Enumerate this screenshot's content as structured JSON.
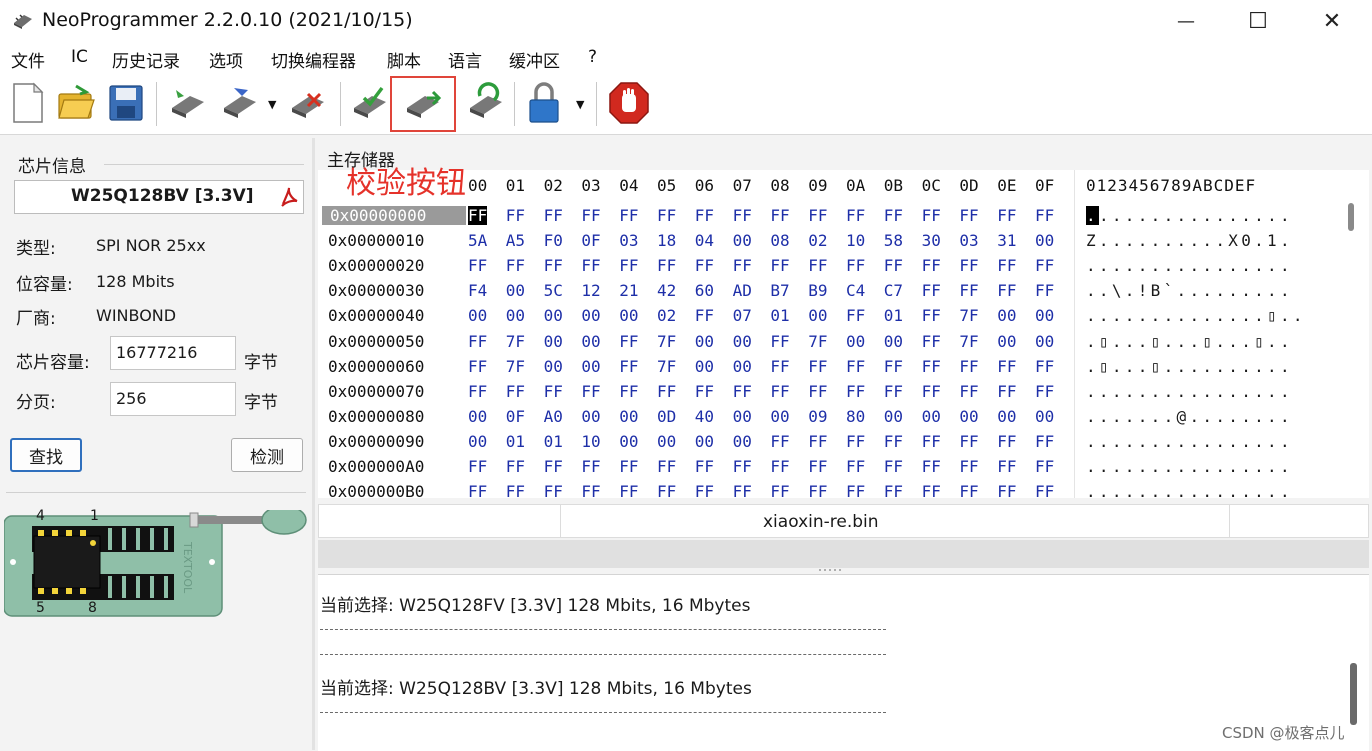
{
  "window": {
    "title": "NeoProgrammer 2.2.0.10 (2021/10/15)",
    "minimize_glyph": "—",
    "maximize_glyph": "☐",
    "close_glyph": "✕"
  },
  "menu": [
    "文件",
    "IC",
    "历史记录",
    "选项",
    "切换编程器",
    "脚本",
    "语言",
    "缓冲区",
    "?"
  ],
  "toolbar": {
    "icons": [
      "new-file-icon",
      "open-folder-icon",
      "save-disk-icon",
      "read-chip-icon",
      "write-chip-icon",
      "erase-chip-icon",
      "check-blank-icon",
      "verify-chip-icon",
      "auto-program-icon",
      "lock-icon",
      "stop-icon"
    ],
    "dropdown_glyph": "▼",
    "accent": "#e0453a"
  },
  "annotation": "校验按钮",
  "chip_info": {
    "group_label": "芯片信息",
    "chip_name": "W25Q128BV [3.3V]",
    "type_label": "类型:",
    "type_value": "SPI NOR 25xx",
    "bits_label": "位容量:",
    "bits_value": "128 Mbits",
    "vendor_label": "厂商:",
    "vendor_value": "WINBOND",
    "size_label": "芯片容量:",
    "size_value": "16777216",
    "size_unit": "字节",
    "page_label": "分页:",
    "page_value": "256",
    "page_unit": "字节",
    "find_button": "查找",
    "detect_button": "检测"
  },
  "socket": {
    "pin_top_left": "4",
    "pin_top_right": "1",
    "pin_bottom_left": "5",
    "pin_bottom_right": "8",
    "brand": "TEXTOOL"
  },
  "memory": {
    "label": "主存储器",
    "columns": [
      "00",
      "01",
      "02",
      "03",
      "04",
      "05",
      "06",
      "07",
      "08",
      "09",
      "0A",
      "0B",
      "0C",
      "0D",
      "0E",
      "0F"
    ],
    "ascii_header": "0123456789ABCDEF",
    "rows": [
      {
        "addr": "0x00000000",
        "bytes": "FF FF FF FF FF FF FF FF FF FF FF FF FF FF FF FF",
        "ascii": "................"
      },
      {
        "addr": "0x00000010",
        "bytes": "5A A5 F0 0F 03 18 04 00 08 02 10 58 30 03 31 00",
        "ascii": "Z..........X0.1."
      },
      {
        "addr": "0x00000020",
        "bytes": "FF FF FF FF FF FF FF FF FF FF FF FF FF FF FF FF",
        "ascii": "................"
      },
      {
        "addr": "0x00000030",
        "bytes": "F4 00 5C 12 21 42 60 AD B7 B9 C4 C7 FF FF FF FF",
        "ascii": "..\\.!B`........."
      },
      {
        "addr": "0x00000040",
        "bytes": "00 00 00 00 00 02 FF 07 01 00 FF 01 FF 7F 00 00",
        "ascii": "..............▯.."
      },
      {
        "addr": "0x00000050",
        "bytes": "FF 7F 00 00 FF 7F 00 00 FF 7F 00 00 FF 7F 00 00",
        "ascii": ".▯...▯...▯...▯.."
      },
      {
        "addr": "0x00000060",
        "bytes": "FF 7F 00 00 FF 7F 00 00 FF FF FF FF FF FF FF FF",
        "ascii": ".▯...▯.........."
      },
      {
        "addr": "0x00000070",
        "bytes": "FF FF FF FF FF FF FF FF FF FF FF FF FF FF FF FF",
        "ascii": "................"
      },
      {
        "addr": "0x00000080",
        "bytes": "00 0F A0 00 00 0D 40 00 00 09 80 00 00 00 00 00",
        "ascii": ".......@........"
      },
      {
        "addr": "0x00000090",
        "bytes": "00 01 01 10 00 00 00 00 FF FF FF FF FF FF FF FF",
        "ascii": "................"
      },
      {
        "addr": "0x000000A0",
        "bytes": "FF FF FF FF FF FF FF FF FF FF FF FF FF FF FF FF",
        "ascii": "................"
      },
      {
        "addr": "0x000000B0",
        "bytes": "FF FF FF FF FF FF FF FF FF FF FF FF FF FF FF FF",
        "ascii": "................"
      }
    ]
  },
  "status": {
    "filename": "xiaoxin-re.bin"
  },
  "log": {
    "line1": "当前选择:   W25Q128FV [3.3V] 128 Mbits, 16 Mbytes",
    "line2": "当前选择:   W25Q128BV [3.3V] 128 Mbits, 16 Mbytes"
  },
  "watermark": "CSDN @极客点儿"
}
